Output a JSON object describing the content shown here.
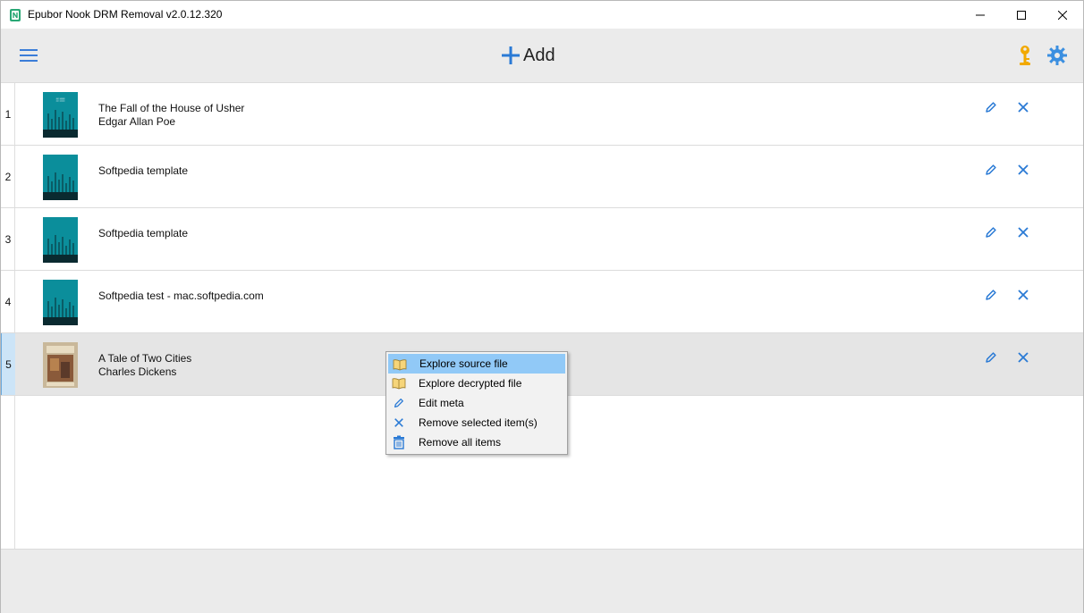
{
  "window": {
    "title": "Epubor Nook DRM Removal v2.0.12.320"
  },
  "toolbar": {
    "add_label": "Add",
    "accent": "#2a7ad5",
    "key_color": "#f2a900"
  },
  "books": [
    {
      "index": "1",
      "title": "The Fall of the House of Usher",
      "author": "Edgar Allan Poe",
      "cover": "teal-cover"
    },
    {
      "index": "2",
      "title": "Softpedia template",
      "author": "",
      "cover": "teal-cover"
    },
    {
      "index": "3",
      "title": "Softpedia template",
      "author": "",
      "cover": "teal-cover"
    },
    {
      "index": "4",
      "title": "Softpedia test - mac.softpedia.com",
      "author": "",
      "cover": "teal-cover"
    },
    {
      "index": "5",
      "title": "A Tale of Two Cities",
      "author": "Charles Dickens",
      "cover": "painting-cover"
    }
  ],
  "selected_row": "5",
  "context_menu": {
    "items": [
      {
        "label": "Explore source file",
        "icon": "book-icon",
        "highlighted": true
      },
      {
        "label": "Explore decrypted file",
        "icon": "book-icon",
        "highlighted": false
      },
      {
        "label": "Edit meta",
        "icon": "pencil-icon",
        "highlighted": false
      },
      {
        "label": "Remove selected item(s)",
        "icon": "x-icon",
        "highlighted": false
      },
      {
        "label": "Remove all items",
        "icon": "trash-icon",
        "highlighted": false
      }
    ]
  }
}
